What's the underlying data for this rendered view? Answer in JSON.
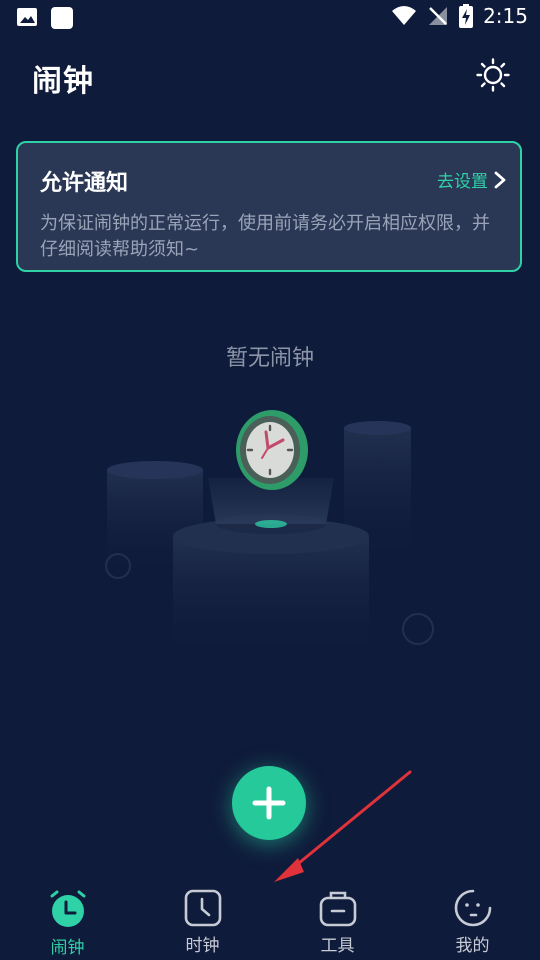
{
  "status_bar": {
    "time": "2:15",
    "icons": [
      "image-icon",
      "square-icon",
      "wifi-icon",
      "no-signal-icon",
      "battery-charging-icon"
    ]
  },
  "header": {
    "title": "闹钟",
    "theme_icon": "sun-icon"
  },
  "notice": {
    "title": "允许通知",
    "action_label": "去设置",
    "text": "为保证闹钟的正常运行，使用前请务必开启相应权限，并仔细阅读帮助须知~"
  },
  "empty_state": {
    "text": "暂无闹钟"
  },
  "fab": {
    "icon": "plus-icon"
  },
  "bottom_nav": {
    "items": [
      {
        "label": "闹钟",
        "icon": "alarm-clock-icon",
        "active": true
      },
      {
        "label": "时钟",
        "icon": "clock-icon",
        "active": false
      },
      {
        "label": "工具",
        "icon": "toolbox-icon",
        "active": false
      },
      {
        "label": "我的",
        "icon": "profile-face-icon",
        "active": false
      }
    ]
  },
  "colors": {
    "background": "#0f1b3a",
    "accent": "#2fd1a7",
    "card": "#2a3755",
    "annotation_arrow": "#e0323a"
  }
}
